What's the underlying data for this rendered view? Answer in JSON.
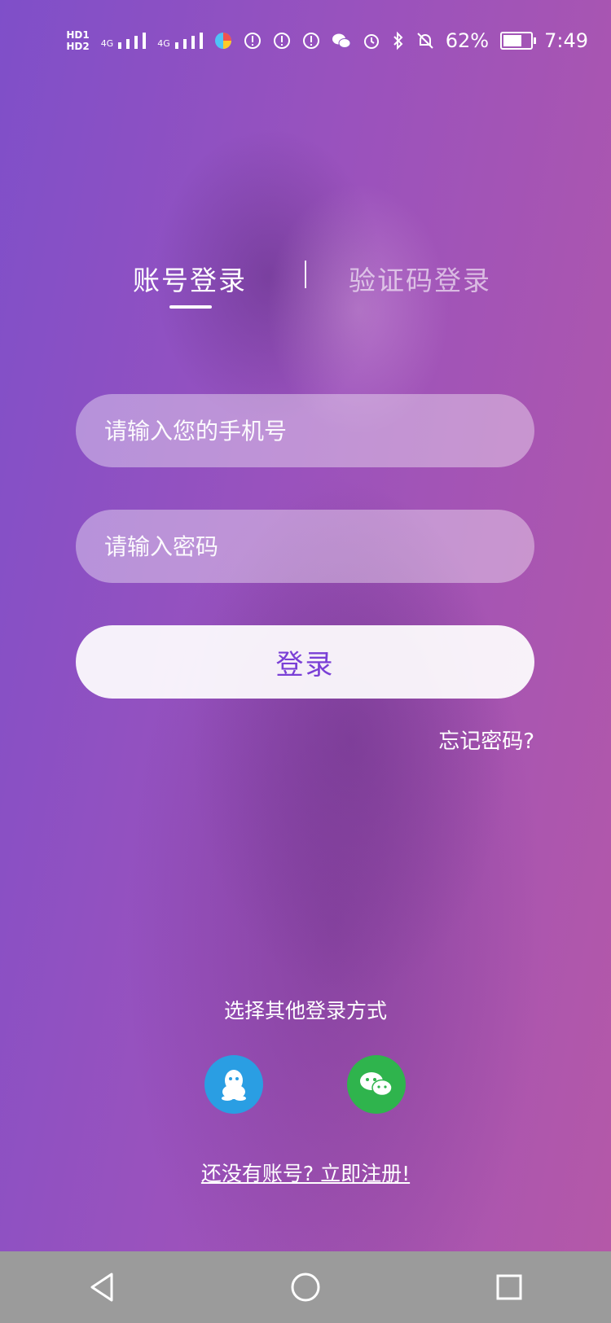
{
  "status_bar": {
    "indicators": [
      "HD1",
      "HD2",
      "4G",
      "4G"
    ],
    "battery_percent": "62%",
    "time": "7:49",
    "icons": [
      "signal-icon",
      "signal-icon",
      "app-icon",
      "alert-icon",
      "alert-icon",
      "alert-icon",
      "wechat-icon",
      "alarm-icon",
      "bluetooth-icon",
      "mute-bell-icon",
      "battery-icon"
    ]
  },
  "tabs": [
    {
      "label": "账号登录",
      "active": true
    },
    {
      "label": "验证码登录",
      "active": false
    }
  ],
  "form": {
    "phone_placeholder": "请输入您的手机号",
    "password_placeholder": "请输入密码",
    "login_button": "登录",
    "forgot_password": "忘记密码?"
  },
  "other_login": {
    "title": "选择其他登录方式",
    "methods": [
      {
        "name": "qq-icon",
        "color": "#2a9ee3"
      },
      {
        "name": "wechat-icon",
        "color": "#2fb44d"
      }
    ]
  },
  "register_link": "还没有账号? 立即注册!",
  "nav_bar": {
    "buttons": [
      "back-icon",
      "home-icon",
      "recent-apps-icon"
    ]
  }
}
